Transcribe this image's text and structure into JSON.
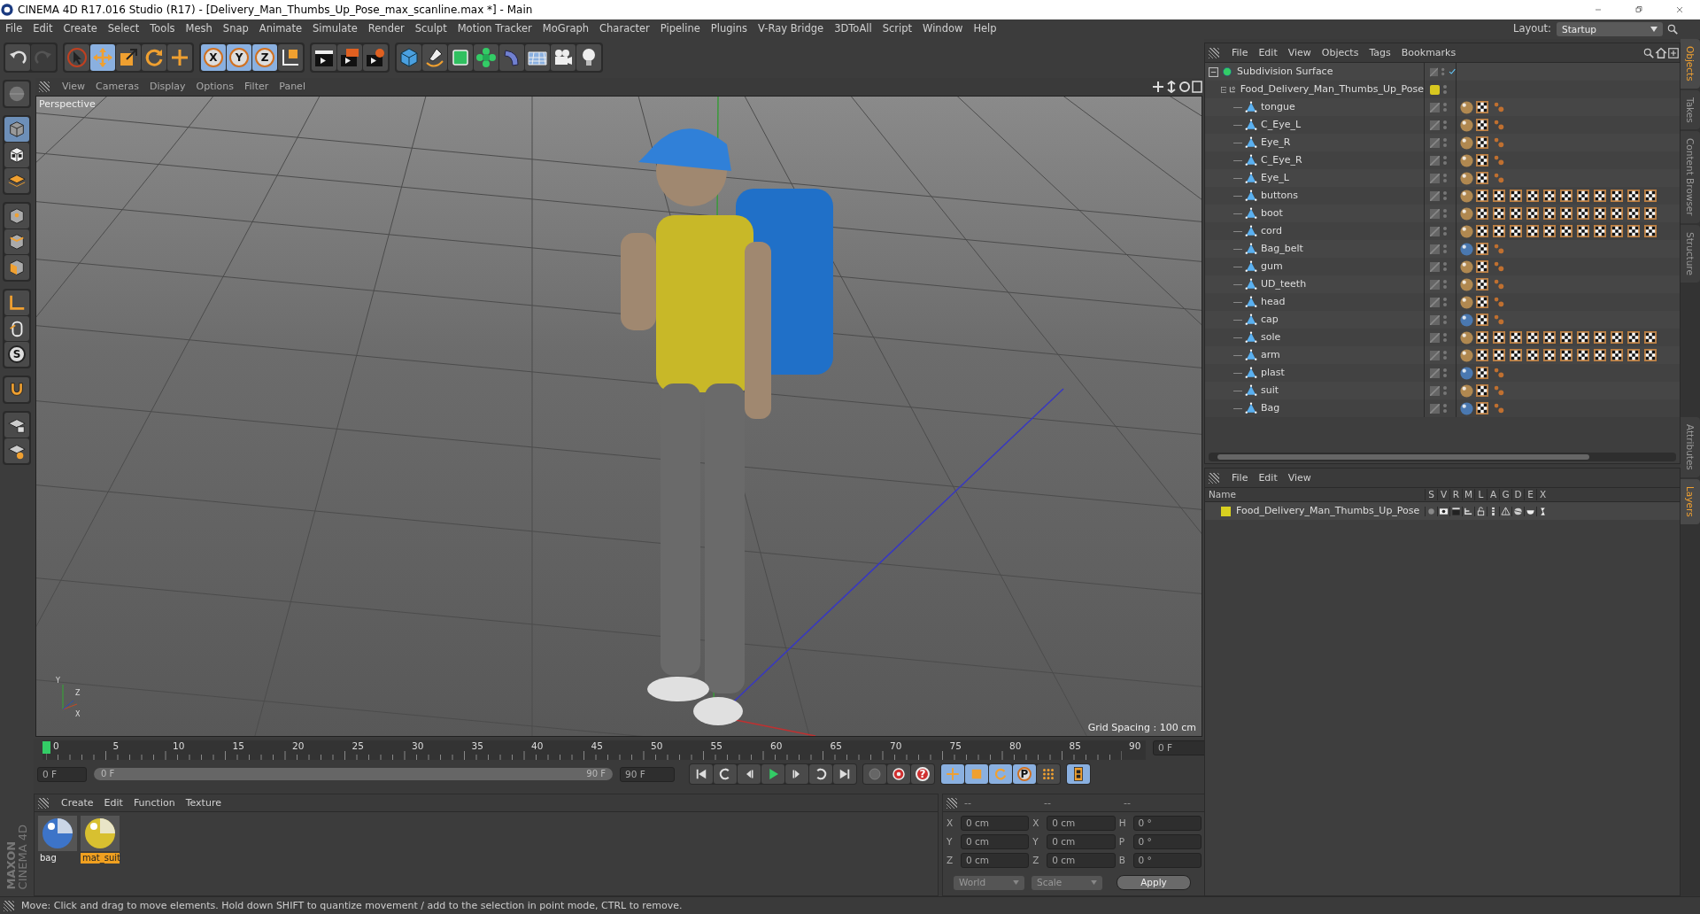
{
  "window": {
    "title": "CINEMA 4D R17.016 Studio (R17) - [Delivery_Man_Thumbs_Up_Pose_max_scanline.max *] - Main"
  },
  "menu_bar": [
    "File",
    "Edit",
    "Create",
    "Select",
    "Tools",
    "Mesh",
    "Snap",
    "Animate",
    "Simulate",
    "Render",
    "Sculpt",
    "Motion Tracker",
    "MoGraph",
    "Character",
    "Pipeline",
    "Plugins",
    "V-Ray Bridge",
    "3DToAll",
    "Script",
    "Window",
    "Help"
  ],
  "layout": {
    "label": "Layout:",
    "value": "Startup"
  },
  "toolbar": [
    [
      {
        "kind": "undo",
        "selected": false,
        "disabled": false
      },
      {
        "kind": "redo",
        "selected": false,
        "disabled": true
      }
    ],
    [
      {
        "kind": "select",
        "selected": false,
        "disabled": false
      },
      {
        "kind": "move",
        "selected": true,
        "disabled": false
      },
      {
        "kind": "scale",
        "selected": false,
        "disabled": false
      },
      {
        "kind": "rotate",
        "selected": false,
        "disabled": false
      },
      {
        "kind": "transform",
        "selected": false,
        "disabled": false
      }
    ],
    [
      {
        "kind": "axis",
        "label": "X",
        "selected": true,
        "disabled": false
      },
      {
        "kind": "axis",
        "label": "Y",
        "selected": true,
        "disabled": false
      },
      {
        "kind": "axis",
        "label": "Z",
        "selected": true,
        "disabled": false
      },
      {
        "kind": "coords",
        "selected": false,
        "disabled": false
      }
    ],
    [
      {
        "kind": "render_view",
        "selected": false,
        "disabled": false
      },
      {
        "kind": "render",
        "selected": false,
        "disabled": false
      },
      {
        "kind": "render_settings",
        "selected": false,
        "disabled": false
      }
    ],
    [
      {
        "kind": "cube",
        "selected": false,
        "disabled": false
      },
      {
        "kind": "pen",
        "selected": false,
        "disabled": false
      },
      {
        "kind": "subdivision",
        "selected": false,
        "disabled": false
      },
      {
        "kind": "cloner",
        "selected": false,
        "disabled": false
      },
      {
        "kind": "deformer",
        "selected": false,
        "disabled": false
      },
      {
        "kind": "floor",
        "selected": false,
        "disabled": false
      },
      {
        "kind": "camera",
        "selected": false,
        "disabled": false
      },
      {
        "kind": "light",
        "selected": false,
        "disabled": false
      }
    ]
  ],
  "left_toolbar": [
    [
      {
        "kind": "make_editable",
        "selected": false
      }
    ],
    [
      {
        "kind": "model",
        "selected": true
      },
      {
        "kind": "texture",
        "selected": false
      },
      {
        "kind": "workplane",
        "selected": false
      }
    ],
    [
      {
        "kind": "points",
        "selected": false
      },
      {
        "kind": "edges",
        "selected": false
      },
      {
        "kind": "polygons",
        "selected": false
      }
    ],
    [
      {
        "kind": "axis_mode",
        "selected": false
      },
      {
        "kind": "tweak",
        "selected": false
      },
      {
        "kind": "solo",
        "label": "S",
        "selected": false
      }
    ],
    [
      {
        "kind": "snap",
        "selected": false
      }
    ],
    [
      {
        "kind": "lock_workplane",
        "selected": false
      },
      {
        "kind": "grid",
        "selected": false
      }
    ]
  ],
  "viewport": {
    "menu": [
      "View",
      "Cameras",
      "Display",
      "Options",
      "Filter",
      "Panel"
    ],
    "camera": "Perspective",
    "grid_spacing": "Grid Spacing : 100 cm",
    "axis_gizmo": [
      "Y",
      "Z",
      "X"
    ]
  },
  "timeline": {
    "ticks": [
      "0",
      "5",
      "10",
      "15",
      "20",
      "25",
      "30",
      "35",
      "40",
      "45",
      "50",
      "55",
      "60",
      "65",
      "70",
      "75",
      "80",
      "85",
      "90"
    ],
    "current_frame": "0 F",
    "start": "0 F",
    "range_start": "0 F",
    "range_end": "90 F",
    "range_level": {
      "level": 1
    },
    "end": "90 F",
    "controls": [
      [
        {
          "kind": "to_start",
          "selected": false
        },
        {
          "kind": "prev_key",
          "selected": false
        },
        {
          "kind": "prev_frame",
          "selected": false
        },
        {
          "kind": "play",
          "selected": false
        },
        {
          "kind": "next_frame",
          "selected": false
        },
        {
          "kind": "next_key",
          "selected": false
        },
        {
          "kind": "to_end",
          "selected": false
        }
      ],
      [
        {
          "kind": "record",
          "selected": false
        },
        {
          "kind": "autokey",
          "selected": false
        },
        {
          "kind": "help",
          "label": "?",
          "selected": false
        }
      ],
      [
        {
          "kind": "key_move",
          "selected": true
        },
        {
          "kind": "key_scale",
          "selected": true
        },
        {
          "kind": "key_rotate",
          "selected": true
        },
        {
          "kind": "key_param",
          "label": "P",
          "selected": true
        },
        {
          "kind": "key_pla",
          "selected": false
        }
      ],
      [
        {
          "kind": "timeline_window",
          "selected": true
        }
      ]
    ]
  },
  "logo": {
    "brand": "MAXON",
    "product": "CINEMA 4D"
  },
  "material_manager": {
    "menu": [
      "Create",
      "Edit",
      "Function",
      "Texture"
    ],
    "materials": [
      {
        "name": "bag",
        "color": "#3d74c8",
        "selected": false
      },
      {
        "name": "mat_suit",
        "color": "#d8c030",
        "selected": true
      }
    ]
  },
  "coordinates": {
    "headers": [
      "--",
      "--",
      "--"
    ],
    "rows": [
      {
        "axis": "X",
        "position": "0 cm",
        "size_axis": "X",
        "size": "0 cm",
        "rotation_axis": "H",
        "rotation": "0 °"
      },
      {
        "axis": "Y",
        "position": "0 cm",
        "size_axis": "Y",
        "size": "0 cm",
        "rotation_axis": "P",
        "rotation": "0 °"
      },
      {
        "axis": "Z",
        "position": "0 cm",
        "size_axis": "Z",
        "size": "0 cm",
        "rotation_axis": "B",
        "rotation": "0 °"
      }
    ],
    "space": "World",
    "mode": "Scale",
    "apply": "Apply"
  },
  "status_bar": "Move: Click and drag to move elements. Hold down SHIFT to quantize movement / add to the selection in point mode, CTRL to remove.",
  "object_manager": {
    "menu": [
      "File",
      "Edit",
      "View",
      "Objects",
      "Tags",
      "Bookmarks"
    ],
    "objects": [
      {
        "name": "Subdivision Surface",
        "kind": "subdivision",
        "expanded": true,
        "enabled": true,
        "children": [
          {
            "name": "Food_Delivery_Man_Thumbs_Up_Pose",
            "kind": "null",
            "expanded": true,
            "color": "#d8c820",
            "children": [
              {
                "name": "tongue",
                "kind": "mesh",
                "tags": [
                  {
                    "kind": "material",
                    "color": "#b08850"
                  },
                  {
                    "kind": "texture"
                  },
                  {
                    "kind": "phong"
                  }
                ]
              },
              {
                "name": "C_Eye_L",
                "kind": "mesh",
                "tags": [
                  {
                    "kind": "material",
                    "color": "#b08850"
                  },
                  {
                    "kind": "texture"
                  },
                  {
                    "kind": "phong"
                  }
                ]
              },
              {
                "name": "Eye_R",
                "kind": "mesh",
                "tags": [
                  {
                    "kind": "material",
                    "color": "#b08850"
                  },
                  {
                    "kind": "texture"
                  },
                  {
                    "kind": "phong"
                  }
                ]
              },
              {
                "name": "C_Eye_R",
                "kind": "mesh",
                "tags": [
                  {
                    "kind": "material",
                    "color": "#b08850"
                  },
                  {
                    "kind": "texture"
                  },
                  {
                    "kind": "phong"
                  }
                ]
              },
              {
                "name": "Eye_L",
                "kind": "mesh",
                "tags": [
                  {
                    "kind": "material",
                    "color": "#b08850"
                  },
                  {
                    "kind": "texture"
                  },
                  {
                    "kind": "phong"
                  }
                ]
              },
              {
                "name": "buttons",
                "kind": "mesh",
                "tags": [
                  {
                    "kind": "material",
                    "color": "#b08850"
                  },
                  {
                    "kind": "texture"
                  },
                  {
                    "kind": "texture"
                  },
                  {
                    "kind": "texture"
                  },
                  {
                    "kind": "texture"
                  },
                  {
                    "kind": "texture"
                  },
                  {
                    "kind": "texture"
                  },
                  {
                    "kind": "texture"
                  },
                  {
                    "kind": "texture"
                  },
                  {
                    "kind": "texture"
                  },
                  {
                    "kind": "texture"
                  },
                  {
                    "kind": "texture"
                  }
                ]
              },
              {
                "name": "boot",
                "kind": "mesh",
                "tags": [
                  {
                    "kind": "material",
                    "color": "#b08850"
                  },
                  {
                    "kind": "texture"
                  },
                  {
                    "kind": "texture"
                  },
                  {
                    "kind": "texture"
                  },
                  {
                    "kind": "texture"
                  },
                  {
                    "kind": "texture"
                  },
                  {
                    "kind": "texture"
                  },
                  {
                    "kind": "texture"
                  },
                  {
                    "kind": "texture"
                  },
                  {
                    "kind": "texture"
                  },
                  {
                    "kind": "texture"
                  },
                  {
                    "kind": "texture"
                  }
                ]
              },
              {
                "name": "cord",
                "kind": "mesh",
                "tags": [
                  {
                    "kind": "material",
                    "color": "#b08850"
                  },
                  {
                    "kind": "texture"
                  },
                  {
                    "kind": "texture"
                  },
                  {
                    "kind": "texture"
                  },
                  {
                    "kind": "texture"
                  },
                  {
                    "kind": "texture"
                  },
                  {
                    "kind": "texture"
                  },
                  {
                    "kind": "texture"
                  },
                  {
                    "kind": "texture"
                  },
                  {
                    "kind": "texture"
                  },
                  {
                    "kind": "texture"
                  },
                  {
                    "kind": "texture"
                  }
                ]
              },
              {
                "name": "Bag_belt",
                "kind": "mesh",
                "tags": [
                  {
                    "kind": "material",
                    "color": "#4a78b0"
                  },
                  {
                    "kind": "texture"
                  },
                  {
                    "kind": "phong"
                  }
                ]
              },
              {
                "name": "gum",
                "kind": "mesh",
                "tags": [
                  {
                    "kind": "material",
                    "color": "#b08850"
                  },
                  {
                    "kind": "texture"
                  },
                  {
                    "kind": "phong"
                  }
                ]
              },
              {
                "name": "UD_teeth",
                "kind": "mesh",
                "tags": [
                  {
                    "kind": "material",
                    "color": "#b08850"
                  },
                  {
                    "kind": "texture"
                  },
                  {
                    "kind": "phong"
                  }
                ]
              },
              {
                "name": "head",
                "kind": "mesh",
                "tags": [
                  {
                    "kind": "material",
                    "color": "#b08850"
                  },
                  {
                    "kind": "texture"
                  },
                  {
                    "kind": "phong"
                  }
                ]
              },
              {
                "name": "cap",
                "kind": "mesh",
                "tags": [
                  {
                    "kind": "material",
                    "color": "#4a78b0"
                  },
                  {
                    "kind": "texture"
                  },
                  {
                    "kind": "phong"
                  }
                ]
              },
              {
                "name": "sole",
                "kind": "mesh",
                "tags": [
                  {
                    "kind": "material",
                    "color": "#b08850"
                  },
                  {
                    "kind": "texture"
                  },
                  {
                    "kind": "texture"
                  },
                  {
                    "kind": "texture"
                  },
                  {
                    "kind": "texture"
                  },
                  {
                    "kind": "texture"
                  },
                  {
                    "kind": "texture"
                  },
                  {
                    "kind": "texture"
                  },
                  {
                    "kind": "texture"
                  },
                  {
                    "kind": "texture"
                  },
                  {
                    "kind": "texture"
                  },
                  {
                    "kind": "texture"
                  }
                ]
              },
              {
                "name": "arm",
                "kind": "mesh",
                "tags": [
                  {
                    "kind": "material",
                    "color": "#b08850"
                  },
                  {
                    "kind": "texture"
                  },
                  {
                    "kind": "texture"
                  },
                  {
                    "kind": "texture"
                  },
                  {
                    "kind": "texture"
                  },
                  {
                    "kind": "texture"
                  },
                  {
                    "kind": "texture"
                  },
                  {
                    "kind": "texture"
                  },
                  {
                    "kind": "texture"
                  },
                  {
                    "kind": "texture"
                  },
                  {
                    "kind": "texture"
                  },
                  {
                    "kind": "texture"
                  }
                ]
              },
              {
                "name": "plast",
                "kind": "mesh",
                "tags": [
                  {
                    "kind": "material",
                    "color": "#4a78b0"
                  },
                  {
                    "kind": "texture"
                  },
                  {
                    "kind": "phong"
                  }
                ]
              },
              {
                "name": "suit",
                "kind": "mesh",
                "tags": [
                  {
                    "kind": "material",
                    "color": "#b08850"
                  },
                  {
                    "kind": "texture"
                  },
                  {
                    "kind": "phong"
                  }
                ]
              },
              {
                "name": "Bag",
                "kind": "mesh",
                "tags": [
                  {
                    "kind": "material",
                    "color": "#4a78b0"
                  },
                  {
                    "kind": "texture"
                  },
                  {
                    "kind": "phong"
                  }
                ]
              }
            ]
          }
        ]
      }
    ]
  },
  "layer_manager": {
    "menu": [
      "File",
      "Edit",
      "View"
    ],
    "columns": [
      "Name",
      "S",
      "V",
      "R",
      "M",
      "L",
      "A",
      "G",
      "D",
      "E",
      "X"
    ],
    "layers": [
      {
        "name": "Food_Delivery_Man_Thumbs_Up_Pose",
        "color": "#d8d020"
      }
    ]
  },
  "side_tabs_top": [
    {
      "label": "Objects",
      "selected": true
    },
    {
      "label": "Takes",
      "selected": false
    },
    {
      "label": "Content Browser",
      "selected": false
    },
    {
      "label": "Structure",
      "selected": false
    }
  ],
  "side_tabs_bottom": [
    {
      "label": "Attributes",
      "selected": false
    },
    {
      "label": "Layers",
      "selected": true
    }
  ]
}
